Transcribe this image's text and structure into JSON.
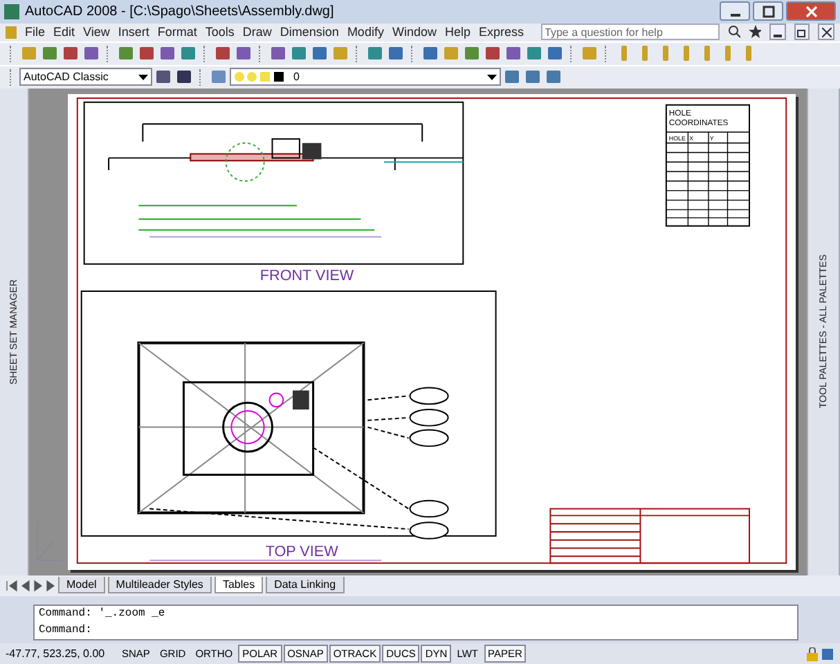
{
  "window": {
    "title": "AutoCAD 2008 - [C:\\Spago\\Sheets\\Assembly.dwg]"
  },
  "menu": [
    "File",
    "Edit",
    "View",
    "Insert",
    "Format",
    "Tools",
    "Draw",
    "Dimension",
    "Modify",
    "Window",
    "Help",
    "Express"
  ],
  "help_search": {
    "placeholder": "Type a question for help"
  },
  "workspace": {
    "value": "AutoCAD Classic"
  },
  "layer": {
    "value": "0"
  },
  "palettes": {
    "left": "SHEET SET MANAGER",
    "right": "TOOL PALETTES - ALL PALETTES"
  },
  "drawing": {
    "front_view": {
      "title": "FRONT VIEW"
    },
    "top_view": {
      "title": "TOP VIEW"
    },
    "hole_table": {
      "title_lines": [
        "HOLE",
        "COORDINATES"
      ],
      "columns": [
        "HOLE",
        "X",
        "Y"
      ]
    }
  },
  "layout_tabs": [
    {
      "label": "Model",
      "selected": false
    },
    {
      "label": "Multileader Styles",
      "selected": false
    },
    {
      "label": "Tables",
      "selected": true
    },
    {
      "label": "Data Linking",
      "selected": false
    }
  ],
  "command_lines": [
    "Command: '_.zoom _e",
    "Command:"
  ],
  "status_bar": {
    "coordinates": "-47.77, 523.25, 0.00",
    "toggles": [
      {
        "label": "SNAP",
        "on": false
      },
      {
        "label": "GRID",
        "on": false
      },
      {
        "label": "ORTHO",
        "on": false
      },
      {
        "label": "POLAR",
        "on": true
      },
      {
        "label": "OSNAP",
        "on": true
      },
      {
        "label": "OTRACK",
        "on": true
      },
      {
        "label": "DUCS",
        "on": true
      },
      {
        "label": "DYN",
        "on": true
      },
      {
        "label": "LWT",
        "on": false
      },
      {
        "label": "PAPER",
        "on": true
      }
    ]
  }
}
